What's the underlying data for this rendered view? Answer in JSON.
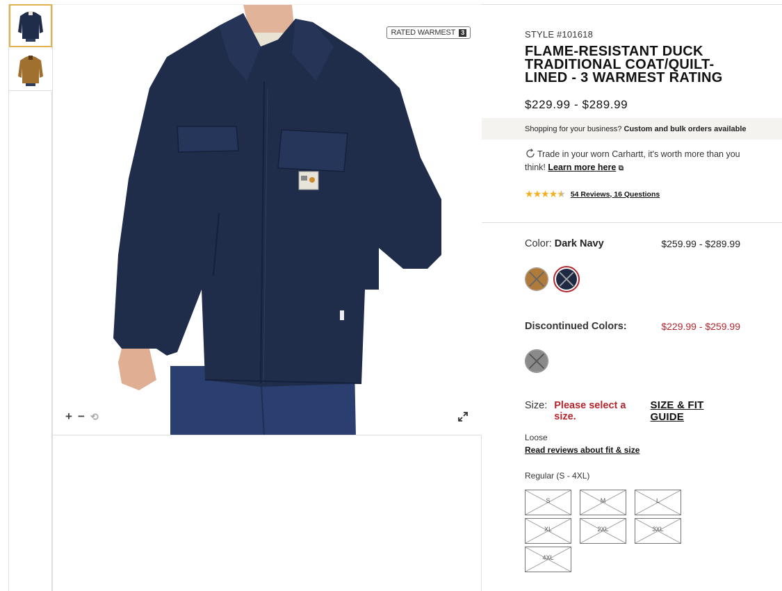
{
  "thumbnails": [
    {
      "name": "Dark Navy jacket front",
      "color": "#1f2c4a"
    },
    {
      "name": "Brown jacket front",
      "color": "#a0702f"
    }
  ],
  "main_image": {
    "badge_label": "RATED WARMEST",
    "badge_number": "3",
    "zoom_in": "+",
    "zoom_out": "−",
    "reset": "⟲"
  },
  "product": {
    "style": "STYLE #101618",
    "title": "FLAME-RESISTANT DUCK TRADITIONAL COAT/QUILT-LINED - 3 WARMEST RATING",
    "price": "$229.99 - $289.99",
    "business_prefix": "Shopping for your business?",
    "business_link": "Custom and bulk orders available",
    "tradein_text": "Trade in your worn Carhartt, it's worth more than you think!",
    "tradein_link": "Learn more here",
    "rating_value": 4.5,
    "reviews_link": "54 Reviews, 16 Questions"
  },
  "color": {
    "label": "Color:",
    "value": "Dark Navy",
    "range": "$259.99 - $289.99",
    "swatches": [
      {
        "name": "Brown",
        "color": "#b07a3b",
        "available": false
      },
      {
        "name": "Dark Navy",
        "color": "#1e2a44",
        "available": false,
        "selected": true
      }
    ]
  },
  "discontinued": {
    "label": "Discontinued Colors:",
    "range": "$229.99 - $259.99",
    "swatches": [
      {
        "name": "Gray",
        "color": "#8a8a8a",
        "available": false
      }
    ]
  },
  "size": {
    "label": "Size:",
    "warning": "Please select a size.",
    "guide": "SIZE & FIT GUIDE",
    "fit_label": "Loose",
    "fit_link": "Read reviews about fit & size",
    "group_label": "Regular (S - 4XL)",
    "options": [
      "S",
      "M",
      "L",
      "XL",
      "2XL",
      "3XL",
      "4XL"
    ]
  },
  "colors": {
    "accent_red": "#b3262d",
    "star": "#f2b01e",
    "thumb_active": "#e3b14a",
    "business_bg": "#f5f3ef"
  }
}
